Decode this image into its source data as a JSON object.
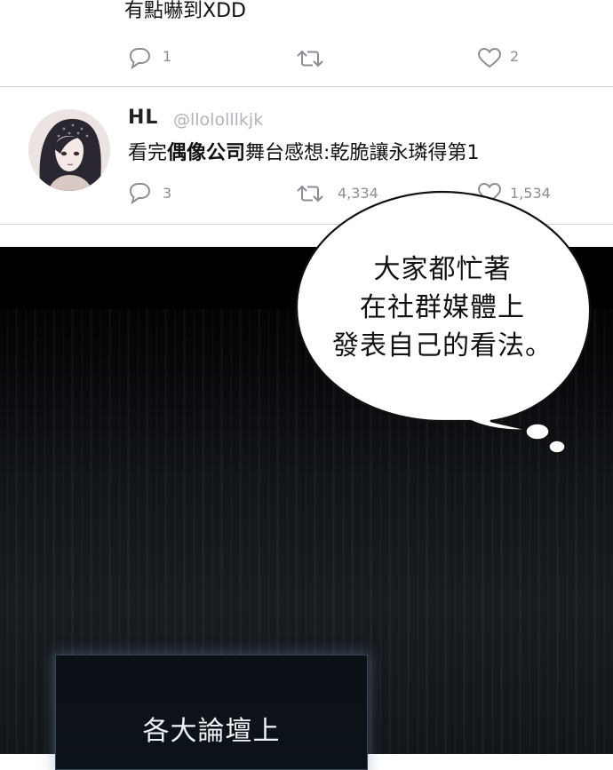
{
  "tweet1": {
    "text": "有點嚇到XDD",
    "reply_count": "1",
    "like_count": "2",
    "icons": [
      "reply-icon",
      "retweet-icon",
      "like-icon"
    ]
  },
  "tweet2": {
    "name": "HL",
    "handle": "@llololllkjk",
    "text_prefix": "看完",
    "text_bold": "偶像公司",
    "text_suffix": "舞台感想:乾脆讓永璘得第1",
    "reply_count": "3",
    "retweet_count": "4,334",
    "like_count": "1,534",
    "icons": [
      "avatar",
      "reply-icon",
      "retweet-icon",
      "like-icon"
    ]
  },
  "speech_bubble": {
    "lines": [
      "大家都忙著",
      "在社群媒體上",
      "發表自己的看法。"
    ]
  },
  "screen": {
    "text": "各大論壇上"
  },
  "colors": {
    "icon_gray": "#8a8f96",
    "handle_gray": "#aeb4ba",
    "divider": "#cfcfcf",
    "panel_dark": "#000000"
  }
}
